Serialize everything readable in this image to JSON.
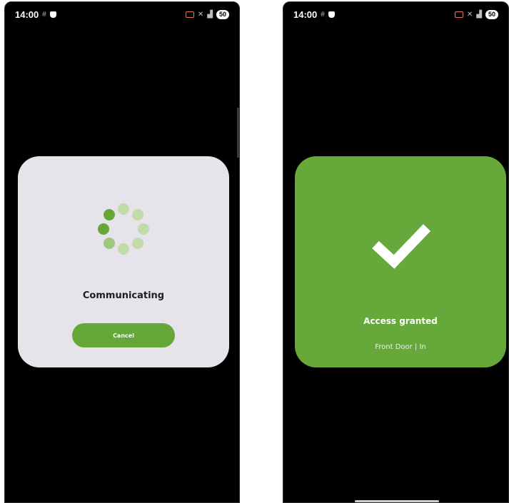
{
  "left_screen": {
    "statusbar": {
      "time": "14:00",
      "battery": "50",
      "icons": [
        "nfc-icon",
        "notification-icon",
        "cast-icon",
        "mute-icon",
        "signal-icon",
        "battery-icon"
      ]
    },
    "dialog": {
      "label": "Communicating",
      "cancel_label": "Cancel",
      "spinner_colors": [
        "#66a838",
        "#bfdcaa"
      ]
    }
  },
  "right_screen": {
    "statusbar": {
      "time": "14:00",
      "battery": "50",
      "icons": [
        "nfc-icon",
        "notification-icon",
        "cast-icon",
        "mute-icon",
        "signal-icon",
        "battery-icon"
      ]
    },
    "dialog": {
      "title": "Access granted",
      "subtitle": "Front Door | In",
      "icon": "checkmark-icon",
      "color": "#66a83a"
    }
  }
}
